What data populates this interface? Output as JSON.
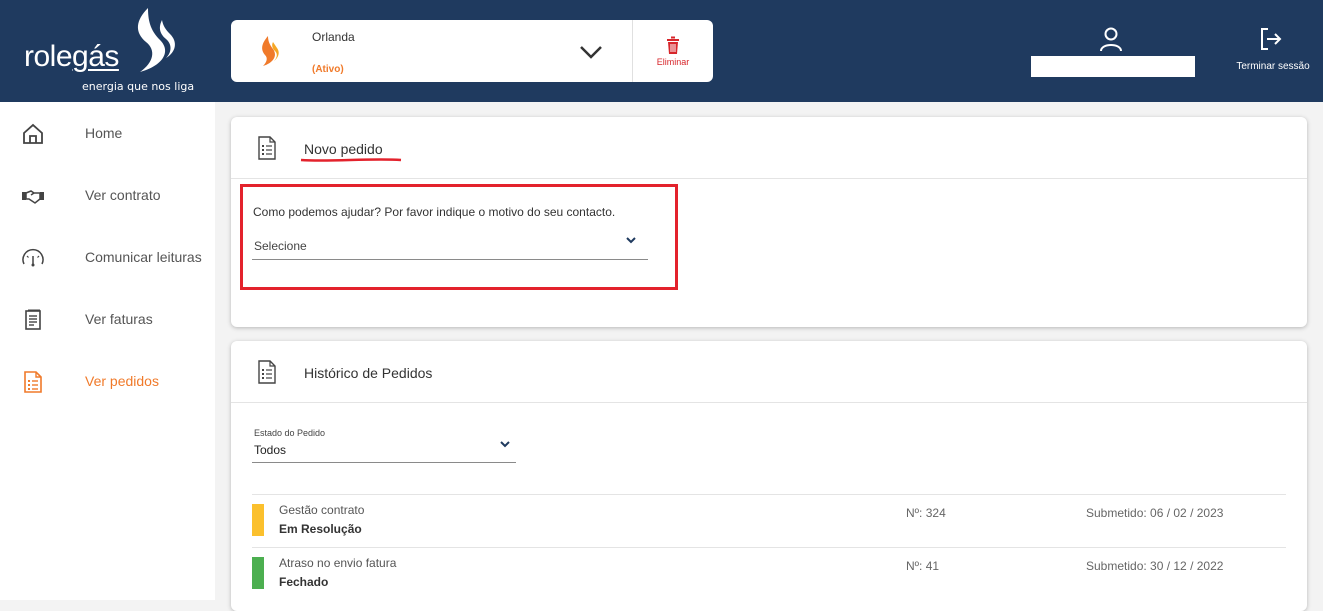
{
  "brand": {
    "name_part1": "role",
    "name_part2": "gás",
    "tagline": "energia que nos liga"
  },
  "contract": {
    "name": "Orlanda",
    "status": "(Ativo)",
    "delete_label": "Eliminar"
  },
  "header": {
    "logout_label": "Terminar sessão"
  },
  "sidebar": {
    "items": [
      {
        "label": "Home",
        "icon": "home-icon"
      },
      {
        "label": "Ver contrato",
        "icon": "handshake-icon"
      },
      {
        "label": "Comunicar leituras",
        "icon": "gauge-icon"
      },
      {
        "label": "Ver faturas",
        "icon": "invoice-icon"
      },
      {
        "label": "Ver pedidos",
        "icon": "requests-icon",
        "active": true
      }
    ]
  },
  "new_request": {
    "title": "Novo pedido",
    "question": "Como podemos ajudar? Por favor indique o motivo do seu contacto.",
    "select_placeholder": "Selecione"
  },
  "history": {
    "title": "Histórico de Pedidos",
    "filter_label": "Estado do Pedido",
    "filter_value": "Todos",
    "rows": [
      {
        "category": "Gestão contrato",
        "status": "Em Resolução",
        "number": "Nº: 324",
        "submitted": "Submetido: 06 / 02 / 2023",
        "status_color": "#fbc02d"
      },
      {
        "category": "Atraso no envio fatura",
        "status": "Fechado",
        "number": "Nº: 41",
        "submitted": "Submetido: 30 / 12 / 2022",
        "status_color": "#4caf50"
      }
    ]
  },
  "colors": {
    "header_bg": "#1f3a5f",
    "accent": "#f07a2a",
    "danger": "#e3222c"
  }
}
